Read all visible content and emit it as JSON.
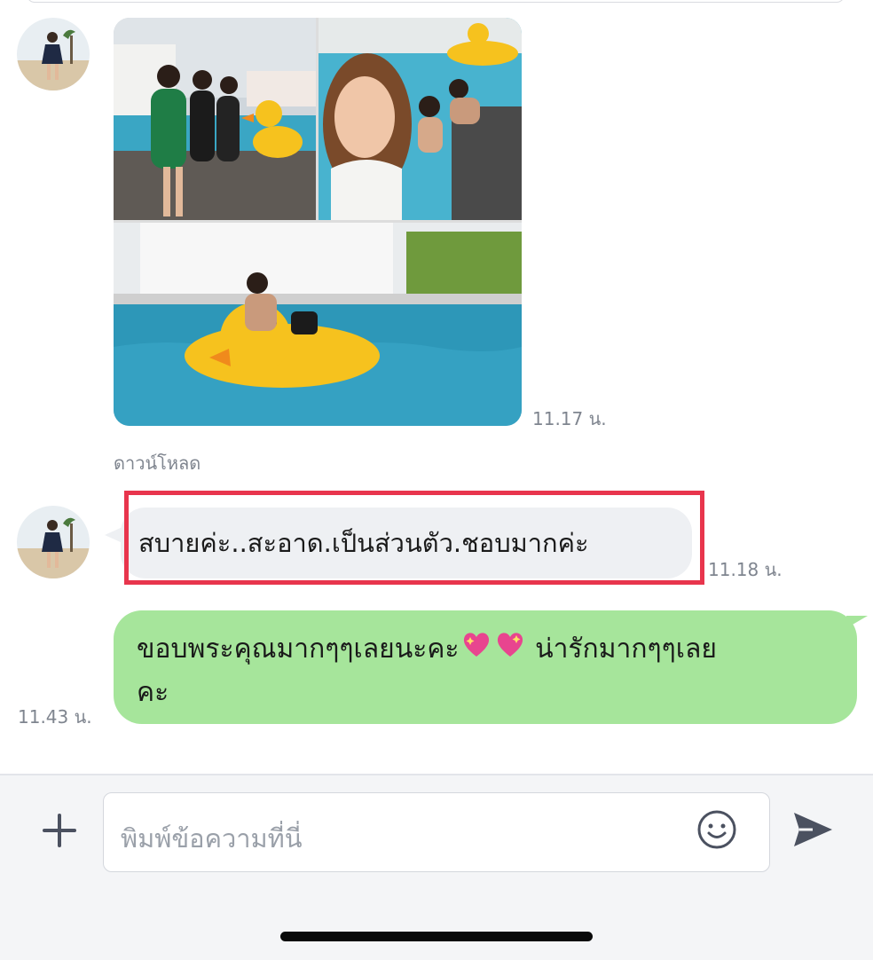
{
  "messages": {
    "photo_time": "11.17 น.",
    "download_label": "ดาวน์โหลด",
    "received_text": "สบายค่ะ..สะอาด.เป็นส่วนตัว.ชอบมากค่ะ",
    "received_time": "11.18 น.",
    "sent_text_1": "ขอบพระคุณมากๆๆเลยนะคะ",
    "sent_text_2": "น่ารักมากๆๆเลย",
    "sent_text_3": "คะ",
    "sent_time": "11.43 น."
  },
  "input_bar": {
    "placeholder": "พิมพ์ข้อความที่นี่"
  },
  "icons": {
    "plus": "plus-icon",
    "emoji": "smiley-icon",
    "send": "send-icon",
    "heart": "sparkling-heart-icon"
  },
  "colors": {
    "sent_bubble": "#a6e59b",
    "received_bubble": "#eef0f3",
    "highlight": "#e8354d",
    "timestamp": "#7f858f"
  }
}
